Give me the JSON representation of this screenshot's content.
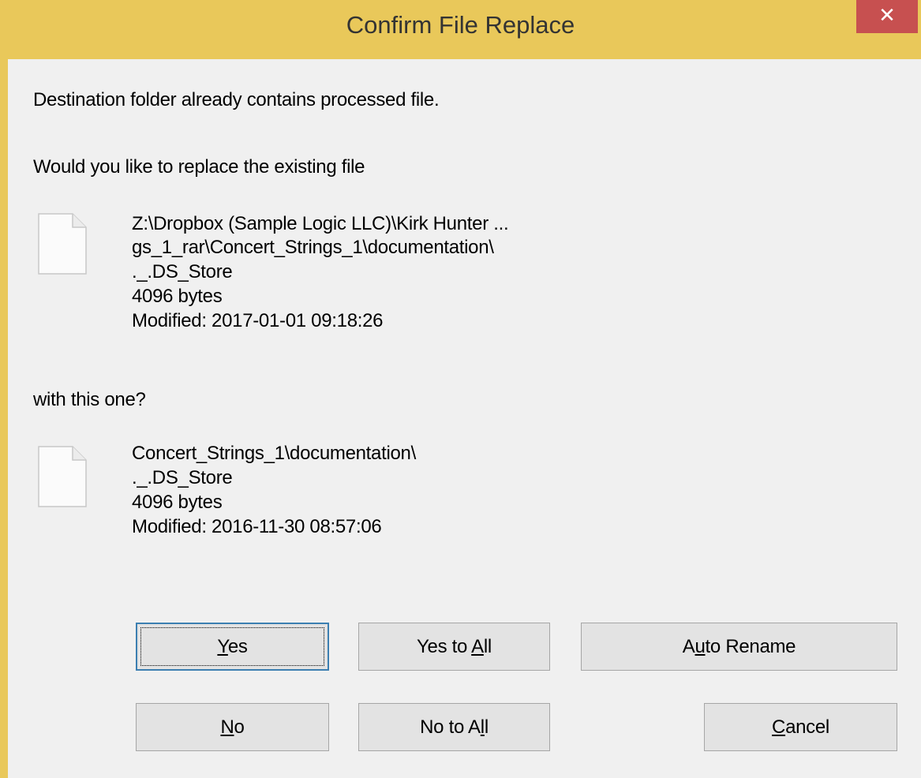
{
  "dialog": {
    "title": "Confirm File Replace",
    "close_glyph": "✕"
  },
  "message": {
    "line1": "Destination folder already contains processed file.",
    "line2": "Would you like to replace the existing file",
    "line3": "with this one?"
  },
  "existing_file": {
    "icon": "file-icon",
    "lines": [
      "Z:\\Dropbox (Sample Logic LLC)\\Kirk Hunter ...",
      "gs_1_rar\\Concert_Strings_1\\documentation\\",
      "._.DS_Store",
      "4096 bytes",
      "Modified: 2017-01-01 09:18:26"
    ]
  },
  "new_file": {
    "icon": "file-icon",
    "lines": [
      "Concert_Strings_1\\documentation\\",
      "._.DS_Store",
      "4096 bytes",
      "Modified: 2016-11-30 08:57:06"
    ]
  },
  "buttons": {
    "yes": {
      "pre": "",
      "key": "Y",
      "post": "es"
    },
    "yes_to_all": {
      "pre": "Yes to ",
      "key": "A",
      "post": "ll"
    },
    "auto_rename": {
      "pre": "A",
      "key": "u",
      "post": "to Rename"
    },
    "no": {
      "pre": "",
      "key": "N",
      "post": "o"
    },
    "no_to_all": {
      "pre": "No to A",
      "key": "l",
      "post": "l"
    },
    "cancel": {
      "pre": "",
      "key": "C",
      "post": "ancel"
    }
  },
  "colors": {
    "titlebar": "#e9c85a",
    "close_button": "#c75050",
    "client": "#f0f0f0",
    "default_button_border": "#3c7fb1"
  }
}
